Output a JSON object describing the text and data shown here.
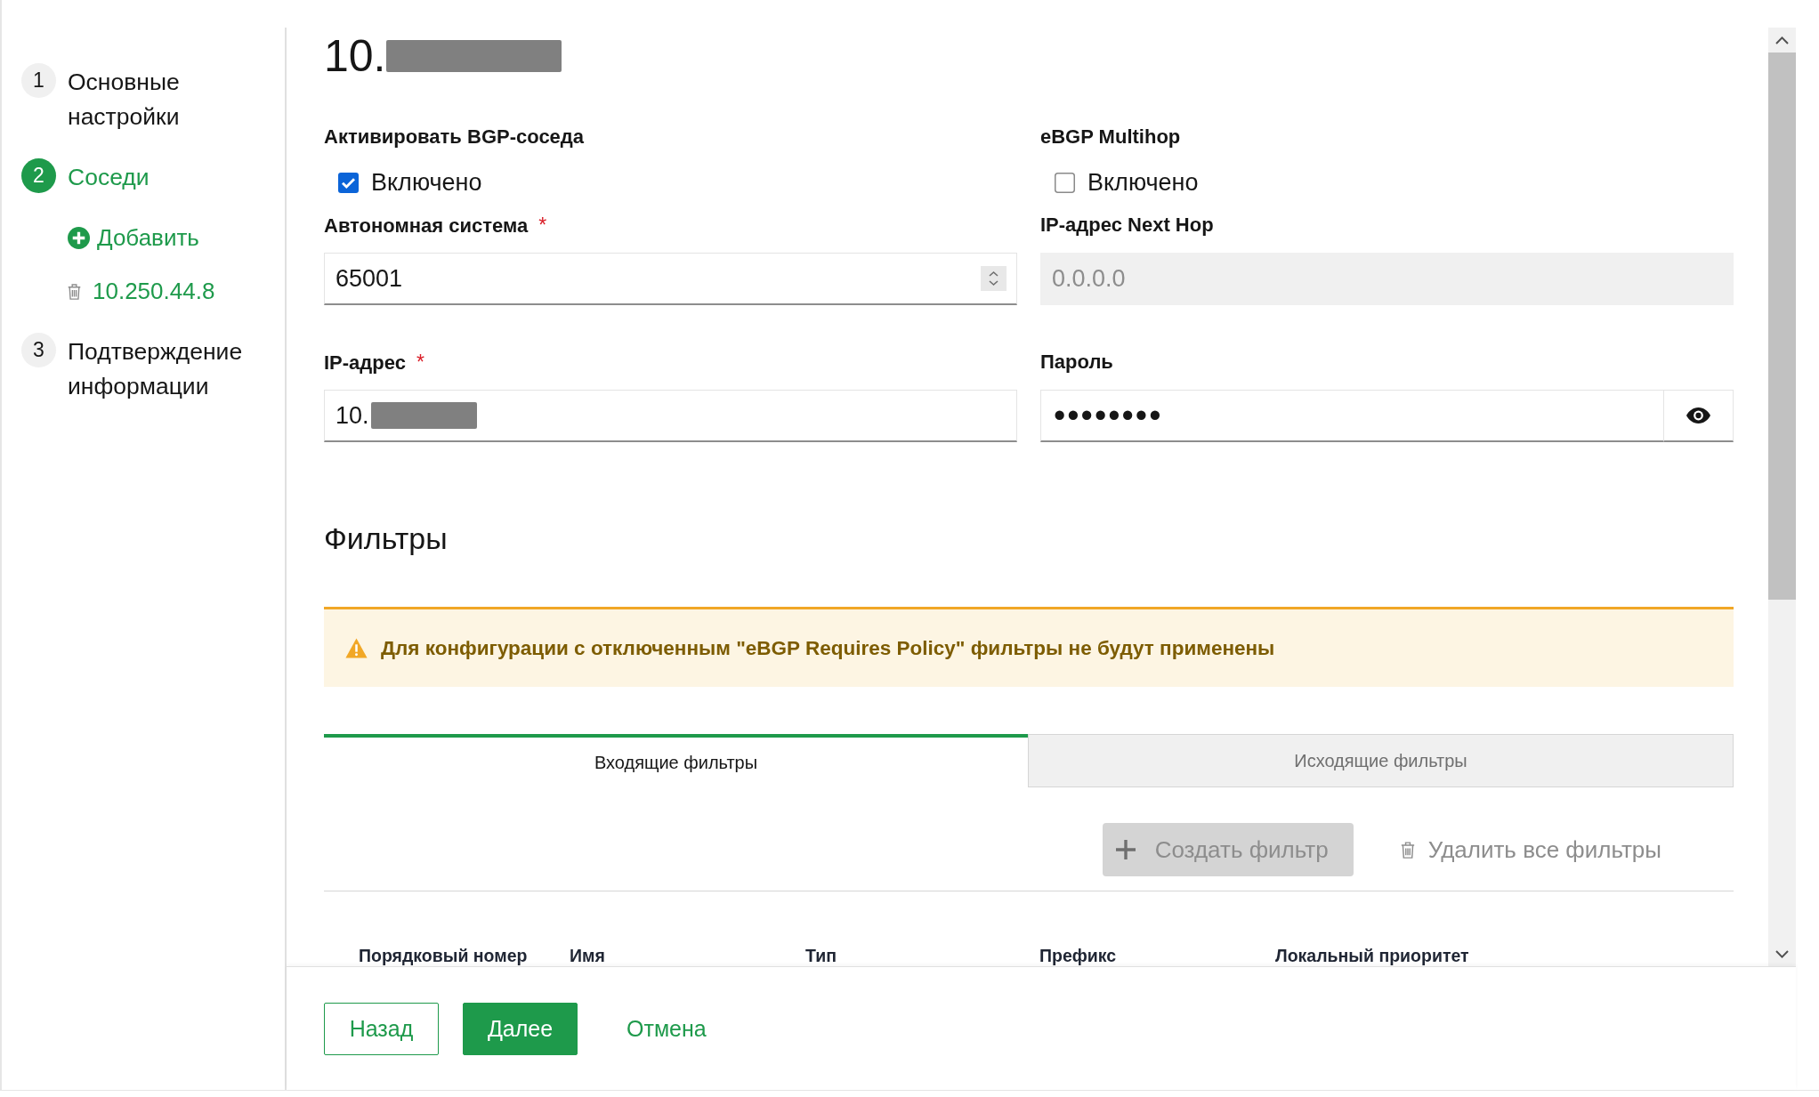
{
  "sidebar": {
    "steps": [
      {
        "number": "1",
        "label": "Основные настройки",
        "selected": false
      },
      {
        "number": "2",
        "label": "Соседи",
        "selected": true,
        "children": [
          {
            "kind": "add",
            "label": "Добавить"
          },
          {
            "kind": "neighbor",
            "label": "10.250.44.8"
          }
        ]
      },
      {
        "number": "3",
        "label": "Подтверждение информации",
        "selected": false
      }
    ]
  },
  "title": {
    "text": "10.",
    "redacted": true
  },
  "form": {
    "fields": [
      {
        "kind": "checkbox",
        "label": "Активировать BGP-соседа",
        "option": "Включено",
        "checked": true
      },
      {
        "kind": "checkbox",
        "label": "eBGP Multihop",
        "option": "Включено",
        "checked": false
      },
      {
        "kind": "number",
        "label": "Автономная система",
        "required_mark": "*",
        "value": "65001"
      },
      {
        "kind": "text",
        "label": "IP-адрес Next Hop",
        "placeholder": "0.0.0.0",
        "disabled": true
      },
      {
        "kind": "text",
        "label": "IP-адрес",
        "required_mark": "*",
        "value": "10.",
        "redacted": true
      },
      {
        "kind": "password",
        "label": "Пароль",
        "value": "••••••••"
      }
    ]
  },
  "filters": {
    "title": "Фильтры",
    "alert": {
      "kind": "warning",
      "text": "Для конфигурации с отключенным \"eBGP Requires Policy\" фильтры не будут применены"
    },
    "tabs": [
      {
        "label": "Входящие фильтры",
        "selected": true
      },
      {
        "label": "Исходящие фильтры",
        "selected": false
      }
    ],
    "actions": [
      {
        "kind": "create",
        "label": "Создать фильтр",
        "disabled": true
      },
      {
        "kind": "delete",
        "label": "Удалить все фильтры",
        "disabled": true
      }
    ],
    "table": {
      "columns": [
        "Порядковый номер",
        "Имя",
        "Тип",
        "Префикс",
        "Локальный приоритет"
      ]
    }
  },
  "footer": {
    "buttons": [
      {
        "kind": "back",
        "label": "Назад"
      },
      {
        "kind": "next",
        "label": "Далее"
      },
      {
        "kind": "cancel",
        "label": "Отмена"
      }
    ]
  }
}
